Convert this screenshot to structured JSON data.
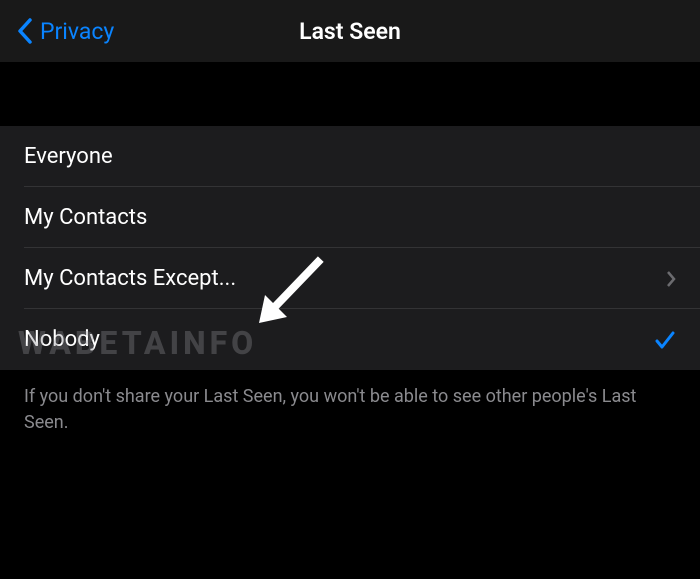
{
  "nav": {
    "back_label": "Privacy",
    "title": "Last Seen"
  },
  "options": {
    "everyone": {
      "label": "Everyone"
    },
    "my_contacts": {
      "label": "My Contacts"
    },
    "my_contacts_except": {
      "label": "My Contacts Except..."
    },
    "nobody": {
      "label": "Nobody"
    }
  },
  "selected": "nobody",
  "footer": "If you don't share your Last Seen, you won't be able to see other people's Last Seen.",
  "watermark": "WABETAINFO"
}
